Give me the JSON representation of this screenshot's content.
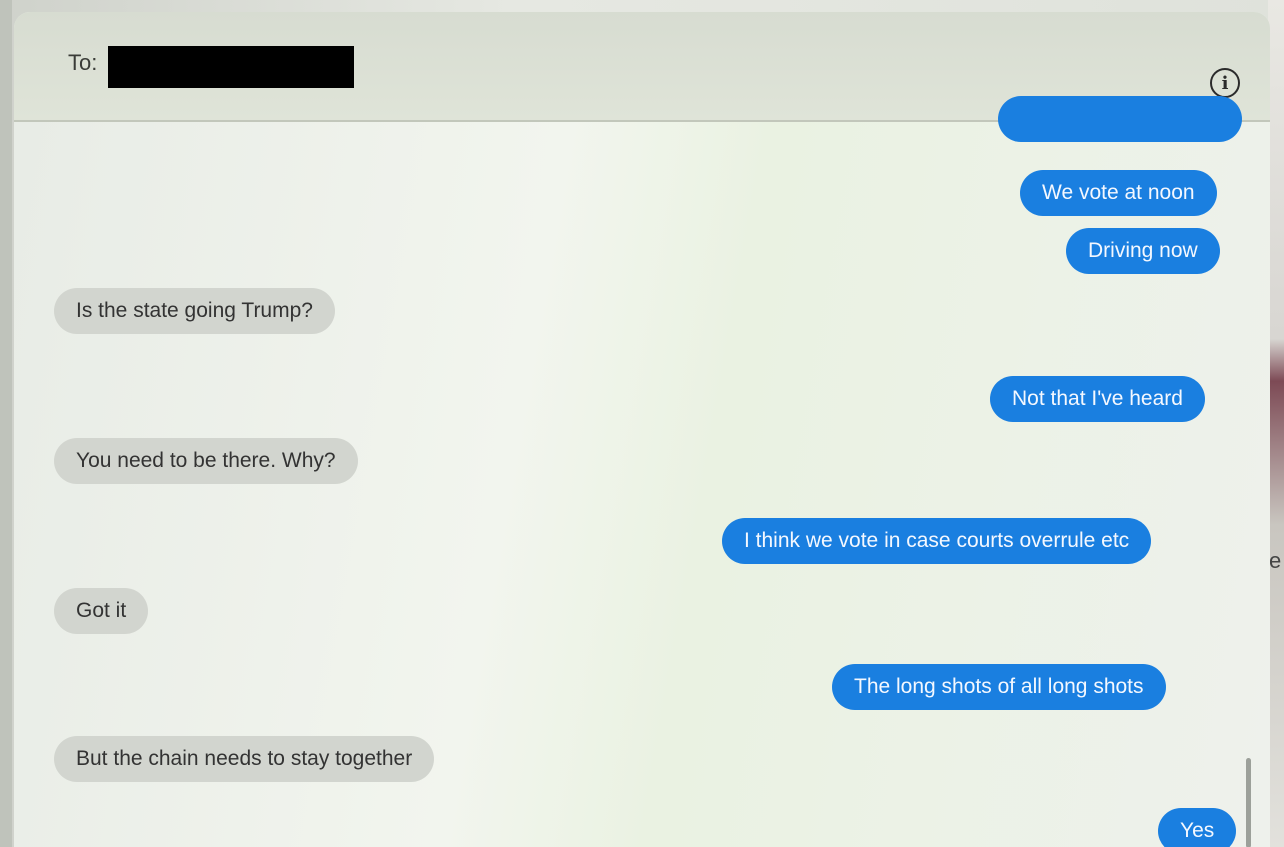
{
  "header": {
    "to_label": "To:",
    "info_icon": "info-icon"
  },
  "messages": [
    {
      "direction": "outgoing",
      "text": ""
    },
    {
      "direction": "outgoing",
      "text": "We vote at noon"
    },
    {
      "direction": "outgoing",
      "text": "Driving now"
    },
    {
      "direction": "incoming",
      "text": "Is the state going Trump?"
    },
    {
      "direction": "outgoing",
      "text": "Not that I've heard"
    },
    {
      "direction": "incoming",
      "text": "You need to be there.  Why?"
    },
    {
      "direction": "outgoing",
      "text": "I think we vote in case courts overrule etc"
    },
    {
      "direction": "incoming",
      "text": "Got it"
    },
    {
      "direction": "outgoing",
      "text": "The long shots of all long shots"
    },
    {
      "direction": "incoming",
      "text": "But the chain needs to stay together"
    },
    {
      "direction": "outgoing",
      "text": "Yes"
    }
  ],
  "colors": {
    "outgoing_bubble": "#1a7fe0",
    "incoming_bubble": "#d2d5cf",
    "background": "#eef1ec"
  }
}
